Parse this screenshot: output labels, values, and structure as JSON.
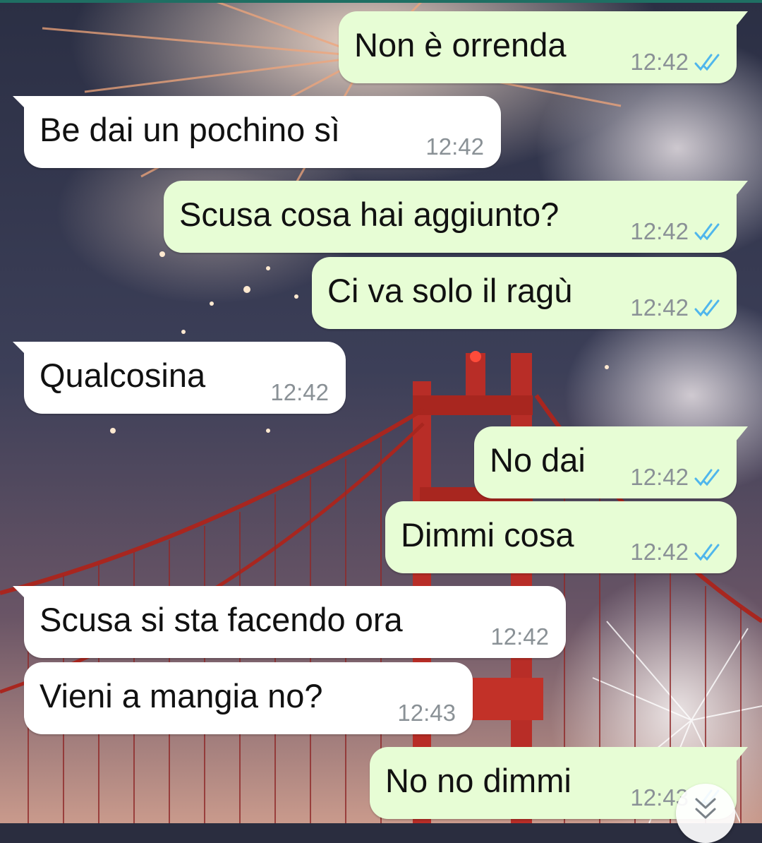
{
  "colors": {
    "outgoing_bubble": "#e7fdd5",
    "incoming_bubble": "#ffffff",
    "read_ticks": "#4fb6ec",
    "timestamp": "#8a9196"
  },
  "messages": [
    {
      "direction": "outgoing",
      "text": "Non è orrenda",
      "time": "12:42",
      "status": "read"
    },
    {
      "direction": "incoming",
      "text": "Be dai un pochino sì",
      "time": "12:42"
    },
    {
      "direction": "outgoing",
      "text": "Scusa cosa hai aggiunto?",
      "time": "12:42",
      "status": "read"
    },
    {
      "direction": "outgoing",
      "text": "Ci va solo il ragù",
      "time": "12:42",
      "status": "read"
    },
    {
      "direction": "incoming",
      "text": "Qualcosina",
      "time": "12:42"
    },
    {
      "direction": "outgoing",
      "text": "No dai",
      "time": "12:42",
      "status": "read"
    },
    {
      "direction": "outgoing",
      "text": "Dimmi cosa",
      "time": "12:42",
      "status": "read"
    },
    {
      "direction": "incoming",
      "text": "Scusa si sta facendo ora",
      "time": "12:42"
    },
    {
      "direction": "incoming",
      "text": "Vieni a mangia no?",
      "time": "12:43"
    },
    {
      "direction": "outgoing",
      "text": "No no dimmi",
      "time": "12:43",
      "status": "read"
    }
  ],
  "scroll_button": {
    "icon": "double-chevron-down-icon"
  }
}
